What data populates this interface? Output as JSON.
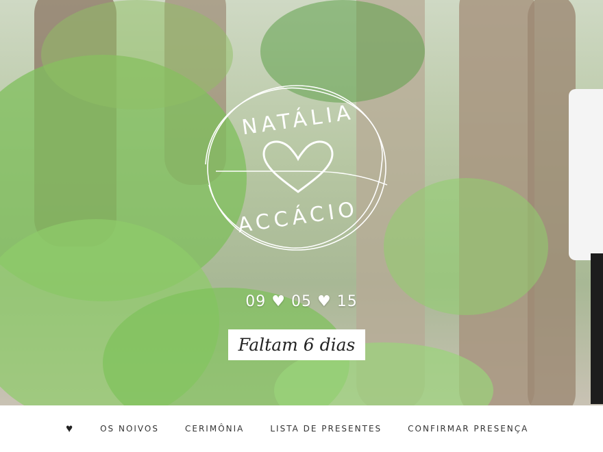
{
  "hero": {
    "logo": {
      "name_top": "NATÁLIA",
      "name_bottom": "ACCÁCIO"
    },
    "date": {
      "day": "09",
      "month": "05",
      "year": "15",
      "separator_icon": "heart-icon"
    },
    "countdown": "Faltam 6 dias"
  },
  "nav": {
    "home_icon": "heart-icon",
    "items": [
      {
        "label": "OS NOIVOS"
      },
      {
        "label": "CERIMÔNIA"
      },
      {
        "label": "LISTA DE PRESENTES"
      },
      {
        "label": "CONFIRMAR PRESENÇA"
      }
    ]
  },
  "colors": {
    "text_dark": "#222222",
    "hero_overlay_text": "#ffffff"
  }
}
